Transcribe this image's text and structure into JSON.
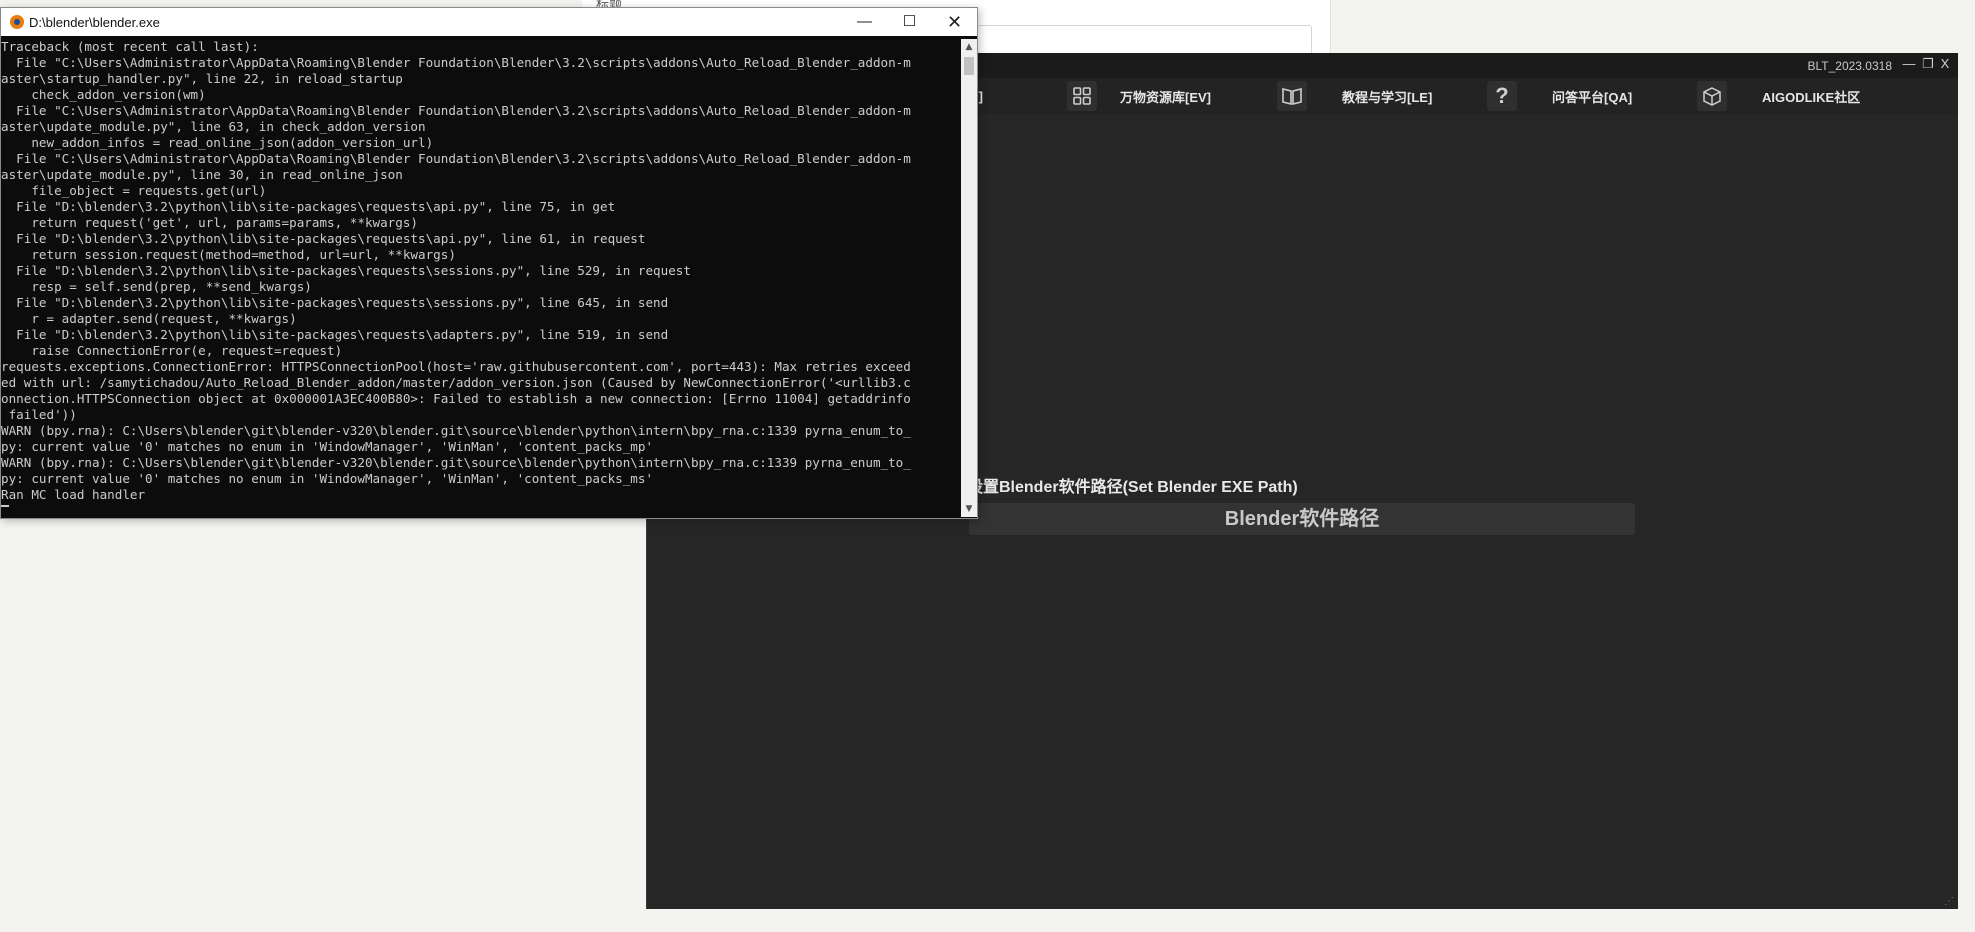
{
  "background": {
    "title": "标题"
  },
  "app": {
    "title": "BLT_2023.0318",
    "controls": {
      "minimize": "—",
      "restore": "❐",
      "close": "X"
    },
    "nav": [
      {
        "label": "[TU]",
        "icon": "grid-icon"
      },
      {
        "label": "万物资源库[EV]",
        "icon": "grid-icon"
      },
      {
        "label": "教程与学习[LE]",
        "icon": "book-icon"
      },
      {
        "label": "问答平台[QA]",
        "icon": "question-icon"
      },
      {
        "label": "AIGODLIKE社区",
        "icon": "cube-icon"
      }
    ],
    "exe_path_label": "设置Blender软件路径(Set Blender EXE Path)",
    "exe_path_button": "Blender软件路径"
  },
  "console": {
    "title": "D:\\blender\\blender.exe",
    "lines": [
      "Traceback (most recent call last):",
      "  File \"C:\\Users\\Administrator\\AppData\\Roaming\\Blender Foundation\\Blender\\3.2\\scripts\\addons\\Auto_Reload_Blender_addon-m",
      "aster\\startup_handler.py\", line 22, in reload_startup",
      "    check_addon_version(wm)",
      "  File \"C:\\Users\\Administrator\\AppData\\Roaming\\Blender Foundation\\Blender\\3.2\\scripts\\addons\\Auto_Reload_Blender_addon-m",
      "aster\\update_module.py\", line 63, in check_addon_version",
      "    new_addon_infos = read_online_json(addon_version_url)",
      "  File \"C:\\Users\\Administrator\\AppData\\Roaming\\Blender Foundation\\Blender\\3.2\\scripts\\addons\\Auto_Reload_Blender_addon-m",
      "aster\\update_module.py\", line 30, in read_online_json",
      "    file_object = requests.get(url)",
      "  File \"D:\\blender\\3.2\\python\\lib\\site-packages\\requests\\api.py\", line 75, in get",
      "    return request('get', url, params=params, **kwargs)",
      "  File \"D:\\blender\\3.2\\python\\lib\\site-packages\\requests\\api.py\", line 61, in request",
      "    return session.request(method=method, url=url, **kwargs)",
      "  File \"D:\\blender\\3.2\\python\\lib\\site-packages\\requests\\sessions.py\", line 529, in request",
      "    resp = self.send(prep, **send_kwargs)",
      "  File \"D:\\blender\\3.2\\python\\lib\\site-packages\\requests\\sessions.py\", line 645, in send",
      "    r = adapter.send(request, **kwargs)",
      "  File \"D:\\blender\\3.2\\python\\lib\\site-packages\\requests\\adapters.py\", line 519, in send",
      "    raise ConnectionError(e, request=request)",
      "requests.exceptions.ConnectionError: HTTPSConnectionPool(host='raw.githubusercontent.com', port=443): Max retries exceed",
      "ed with url: /samytichadou/Auto_Reload_Blender_addon/master/addon_version.json (Caused by NewConnectionError('<urllib3.c",
      "onnection.HTTPSConnection object at 0x000001A3EC400B80>: Failed to establish a new connection: [Errno 11004] getaddrinfo",
      " failed'))",
      "WARN (bpy.rna): C:\\Users\\blender\\git\\blender-v320\\blender.git\\source\\blender\\python\\intern\\bpy_rna.c:1339 pyrna_enum_to_",
      "py: current value '0' matches no enum in 'WindowManager', 'WinMan', 'content_packs_mp'",
      "WARN (bpy.rna): C:\\Users\\blender\\git\\blender-v320\\blender.git\\source\\blender\\python\\intern\\bpy_rna.c:1339 pyrna_enum_to_",
      "py: current value '0' matches no enum in 'WindowManager', 'WinMan', 'content_packs_ms'",
      "Ran MC load handler"
    ]
  }
}
